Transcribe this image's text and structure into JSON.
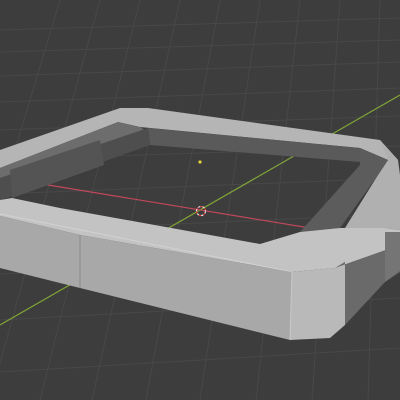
{
  "viewport": {
    "background": "#3d3d3d",
    "grid_color": "#4a4a4a",
    "x_axis_color": "#c0485c",
    "y_axis_color": "#7fa336"
  },
  "object": {
    "shape": "beveled square frame",
    "light_color": "#b5b5b5",
    "mid_color": "#9b9b9b",
    "dark_color": "#555555",
    "edge_highlight": "#cfcfcf"
  },
  "icons": {
    "cursor": "3d-cursor-icon",
    "light": "light-object-icon"
  },
  "cursor_color": "#e8e8e8",
  "light_dot_color": "#e6d23a"
}
